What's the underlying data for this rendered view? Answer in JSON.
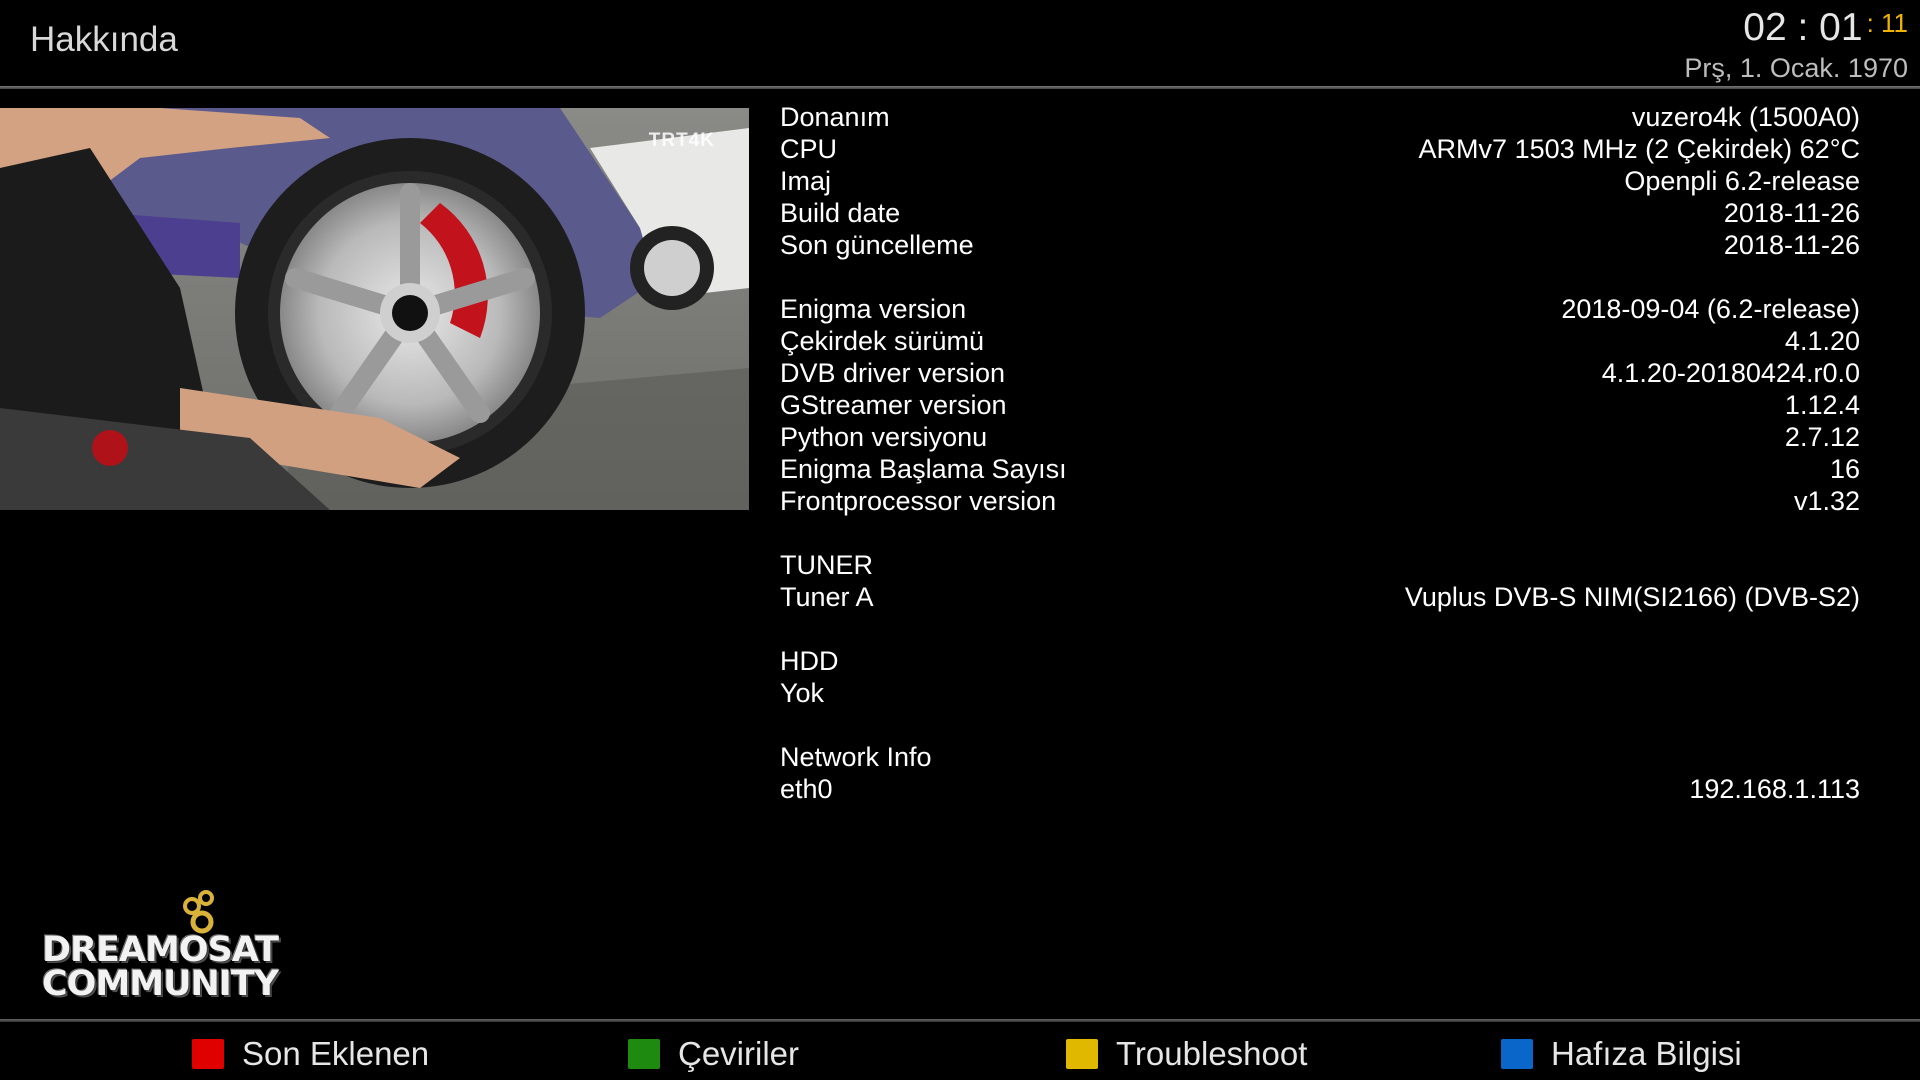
{
  "header": {
    "title": "Hakkında",
    "clock": {
      "time": "02 : 01",
      "seconds": ": 11",
      "date": "Prş,  1. Ocak. 1970"
    }
  },
  "preview": {
    "channel_logo": "TRT4K"
  },
  "info": {
    "system": [
      {
        "label": "Donanım",
        "value": "vuzero4k (1500A0)"
      },
      {
        "label": "CPU",
        "value": "ARMv7 1503 MHz (2 Çekirdek) 62°C"
      },
      {
        "label": "Imaj",
        "value": "Openpli 6.2-release"
      },
      {
        "label": "Build date",
        "value": "2018-11-26"
      },
      {
        "label": "Son güncelleme",
        "value": "2018-11-26"
      }
    ],
    "software": [
      {
        "label": "Enigma version",
        "value": "2018-09-04 (6.2-release)"
      },
      {
        "label": "Çekirdek sürümü",
        "value": "4.1.20"
      },
      {
        "label": "DVB driver version",
        "value": "4.1.20-20180424.r0.0"
      },
      {
        "label": "GStreamer version",
        "value": "1.12.4"
      },
      {
        "label": "Python versiyonu",
        "value": "2.7.12"
      },
      {
        "label": "Enigma Başlama Sayısı",
        "value": "16"
      },
      {
        "label": "Frontprocessor version",
        "value": "v1.32"
      }
    ],
    "tuner": {
      "heading": "TUNER",
      "rows": [
        {
          "label": "Tuner A",
          "value": "Vuplus DVB-S NIM(SI2166) (DVB-S2)"
        }
      ]
    },
    "hdd": {
      "heading": "HDD",
      "rows": [
        {
          "label": "Yok",
          "value": ""
        }
      ]
    },
    "network": {
      "heading": "Network Info",
      "rows": [
        {
          "label": "eth0",
          "value": "192.168.1.113"
        }
      ]
    }
  },
  "logo": {
    "line1": "DREAMOSAT",
    "line2": "COMMUNITY"
  },
  "footer": {
    "red": {
      "label": "Son Eklenen",
      "color": "#e00000"
    },
    "green": {
      "label": "Çeviriler",
      "color": "#1f8a10"
    },
    "yellow": {
      "label": "Troubleshoot",
      "color": "#e0b800"
    },
    "blue": {
      "label": "Hafıza Bilgisi",
      "color": "#0a66c8"
    }
  }
}
